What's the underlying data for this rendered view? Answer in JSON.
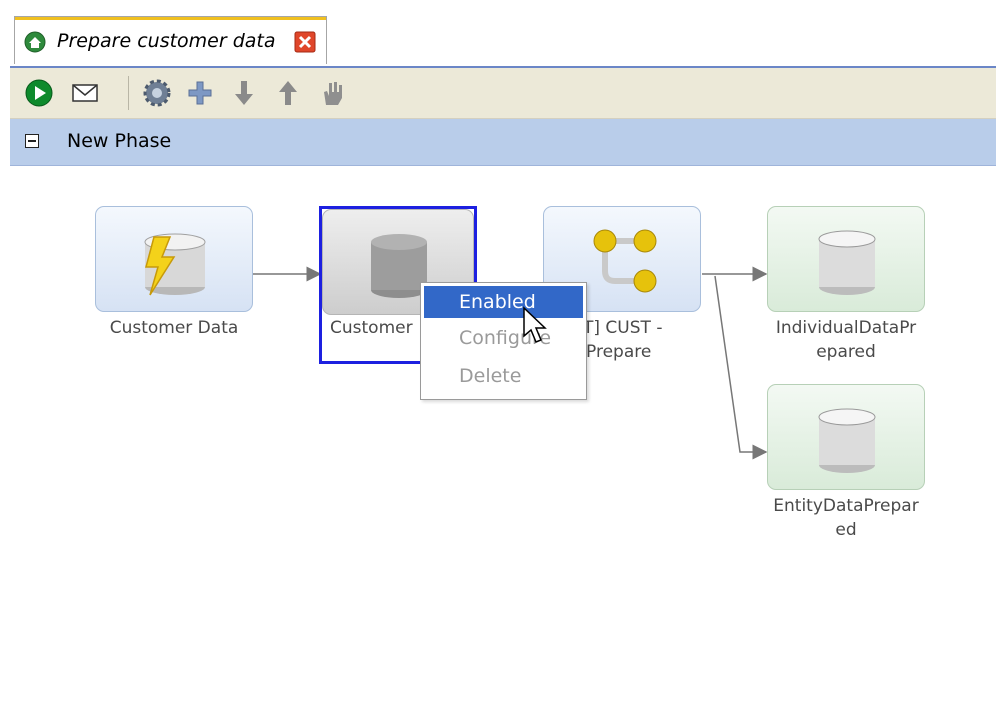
{
  "tab": {
    "title": "Prepare customer data"
  },
  "toolbar": {
    "buttons": [
      "run-icon",
      "email-icon",
      "settings-icon",
      "add-icon",
      "move-down-icon",
      "move-up-icon",
      "hand-icon"
    ]
  },
  "phase": {
    "label": "New Phase"
  },
  "nodes": [
    {
      "label": "Customer Data",
      "icon": "trigger-database-icon"
    },
    {
      "label": "Customer",
      "icon": "database-icon"
    },
    {
      "label_line1": "IT] CUST -",
      "label_line2": "Prepare",
      "icon": "split-process-icon"
    },
    {
      "label_line1": "IndividualDataPr",
      "label_line2": "epared",
      "icon": "database-icon"
    },
    {
      "label_line1": "EntityDataPrepar",
      "label_line2": "ed",
      "icon": "database-icon"
    }
  ],
  "context_menu": {
    "items": [
      {
        "label": "Enabled",
        "state": "highlighted"
      },
      {
        "label": "Configure",
        "state": "disabled"
      },
      {
        "label": "Delete",
        "state": "disabled"
      }
    ]
  },
  "colors": {
    "phase_bar": "#b9cdea",
    "selection": "#1d20e0",
    "menu_highlight": "#3268c8",
    "toolbar": "#ece9d8"
  }
}
